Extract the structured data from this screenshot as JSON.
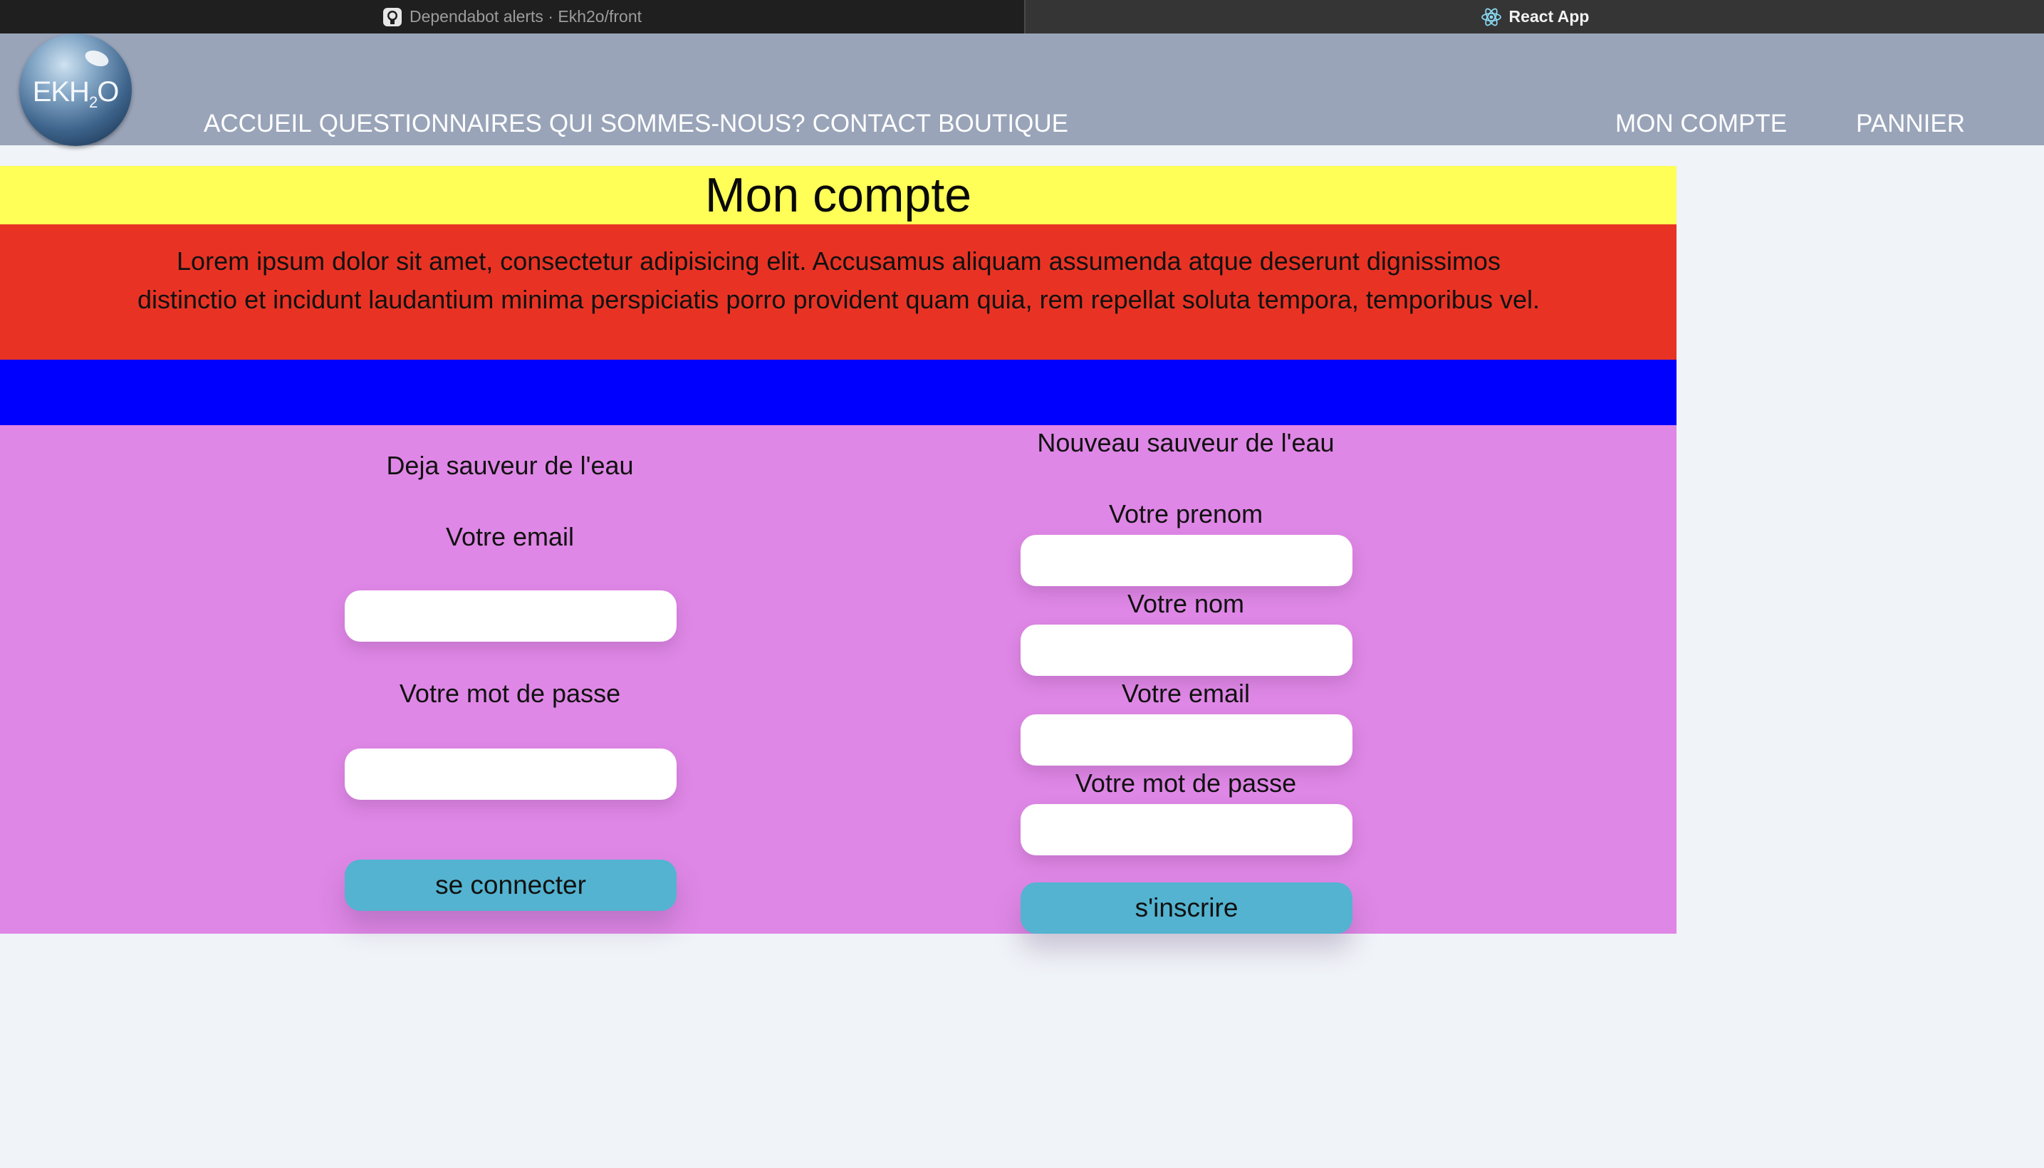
{
  "browser": {
    "tabs": [
      {
        "label": "Dependabot alerts · Ekh2o/front",
        "icon": "github-icon"
      },
      {
        "label": "React App",
        "icon": "react-icon"
      }
    ]
  },
  "header": {
    "logo_text": "EKH",
    "logo_sub": "2",
    "logo_tail": "O",
    "nav": [
      "ACCUEIL",
      "QUESTIONNAIRES",
      "QUI SOMMES-NOUS?",
      "CONTACT",
      "BOUTIQUE"
    ],
    "account": "MON COMPTE",
    "cart": "PANNIER"
  },
  "page": {
    "title": "Mon compte",
    "intro": "Lorem ipsum dolor sit amet, consectetur adipisicing elit. Accusamus aliquam assumenda atque deserunt dignissimos distinctio et incidunt laudantium minima perspiciatis porro provident quam quia, rem repellat soluta tempora, temporibus vel."
  },
  "login": {
    "heading": "Deja sauveur de l'eau",
    "email_label": "Votre email",
    "email_value": "",
    "password_label": "Votre mot de passe",
    "password_value": "",
    "submit": "se connecter"
  },
  "signup": {
    "heading": "Nouveau sauveur de l'eau",
    "firstname_label": "Votre prenom",
    "lastname_label": "Votre nom",
    "email_label": "Votre email",
    "password_label": "Votre mot de passe",
    "submit": "s'inscrire"
  },
  "colors": {
    "header_bg": "#99a4b9",
    "title_band": "#ffff57",
    "intro_band": "#e83324",
    "blue_band": "#0000ff",
    "forms_band": "#df87e6",
    "button": "#53b3d0"
  }
}
